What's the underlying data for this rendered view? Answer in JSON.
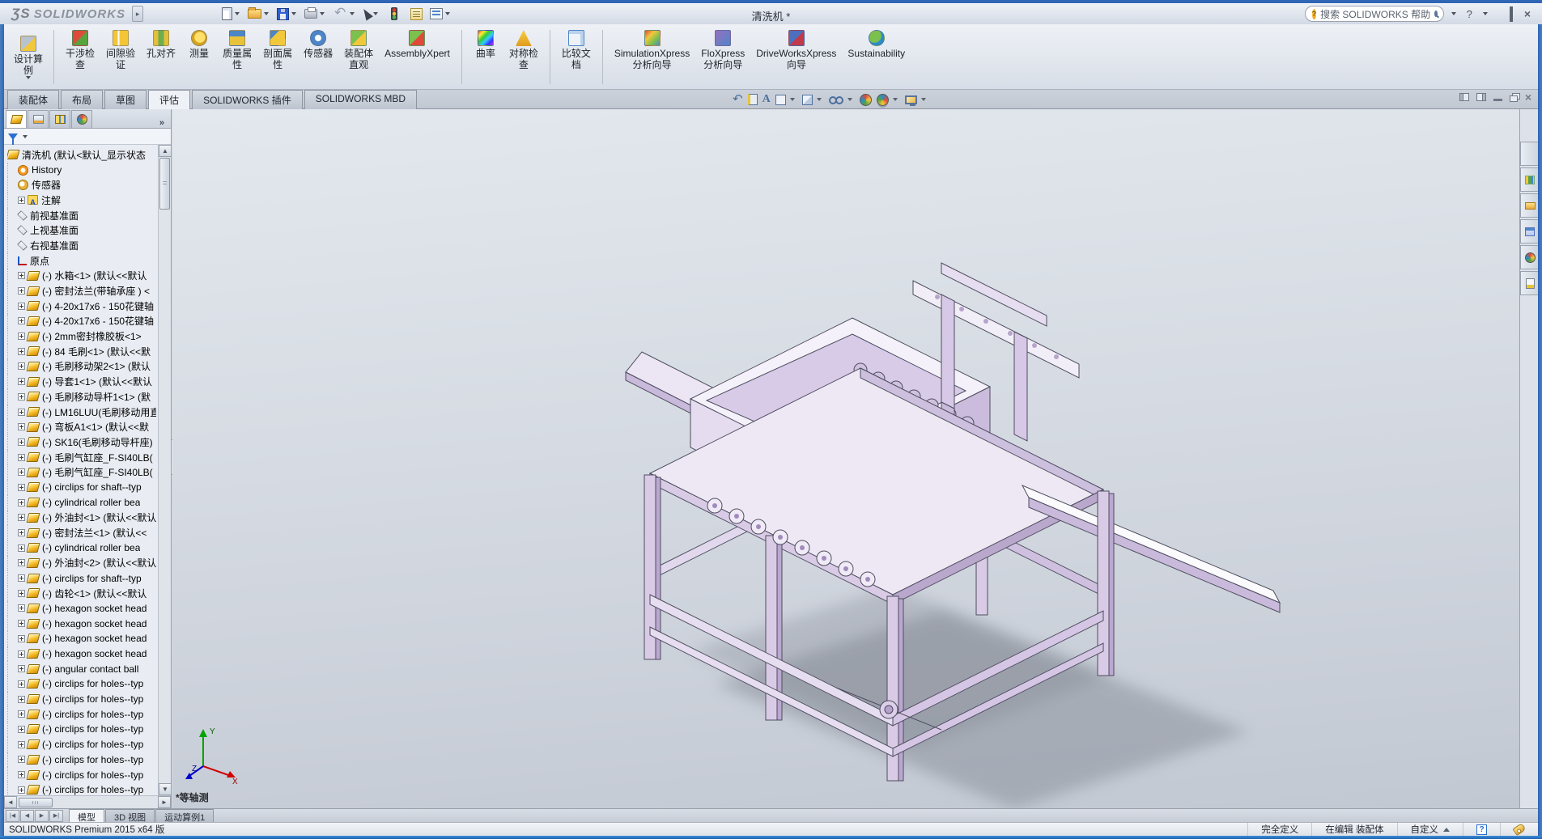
{
  "chrome": {
    "brand_prefix": "ƷS",
    "brand": "SOLIDWORKS",
    "title": "清洗机 *",
    "search_placeholder": "搜索 SOLIDWORKS 帮助",
    "help_glyph": "?",
    "close_glyph": "×"
  },
  "main_toolbar": [
    {
      "name": "new-document",
      "dropdown": true
    },
    {
      "name": "open",
      "dropdown": true
    },
    {
      "name": "save",
      "dropdown": true
    },
    {
      "name": "print",
      "dropdown": true
    },
    {
      "name": "undo",
      "dropdown": true,
      "glyph": "↶"
    },
    {
      "name": "select",
      "dropdown": true,
      "pressed": true
    },
    {
      "name": "rebuild",
      "dropdown": false
    },
    {
      "name": "file-properties",
      "dropdown": false
    },
    {
      "name": "options",
      "dropdown": true
    }
  ],
  "ribbon": {
    "primary": {
      "name": "design-study",
      "label": "设计算\n例"
    },
    "groups": [
      {
        "items": [
          {
            "name": "interference-detection",
            "label": "干涉检\n查"
          },
          {
            "name": "clearance-verification",
            "label": "间隙验\n证"
          },
          {
            "name": "hole-alignment",
            "label": "孔对齐"
          },
          {
            "name": "measure",
            "label": "测量"
          },
          {
            "name": "mass-properties",
            "label": "质量属\n性"
          },
          {
            "name": "section-properties",
            "label": "剖面属\n性"
          },
          {
            "name": "sensor",
            "label": "传感器"
          },
          {
            "name": "assembly-visualization",
            "label": "装配体\n直观"
          },
          {
            "name": "assemblyxpert",
            "label": "AssemblyXpert"
          }
        ]
      },
      {
        "items": [
          {
            "name": "curvature",
            "label": "曲率"
          },
          {
            "name": "symmetry-check",
            "label": "对称检\n查"
          }
        ]
      },
      {
        "items": [
          {
            "name": "compare-documents",
            "label": "比较文\n档"
          }
        ]
      },
      {
        "items": [
          {
            "name": "simulationxpress",
            "label": "SimulationXpress\n分析向导"
          },
          {
            "name": "floxpress",
            "label": "FloXpress\n分析向导"
          },
          {
            "name": "driveworksxpress",
            "label": "DriveWorksXpress\n向导"
          },
          {
            "name": "sustainability",
            "label": "Sustainability"
          }
        ]
      }
    ]
  },
  "cm_tabs": [
    {
      "label": "装配体"
    },
    {
      "label": "布局"
    },
    {
      "label": "草图"
    },
    {
      "label": "评估",
      "active": true
    },
    {
      "label": "SOLIDWORKS 插件"
    },
    {
      "label": "SOLIDWORKS MBD"
    }
  ],
  "headsup": [
    {
      "name": "zoom-to-fit",
      "shape": "mag"
    },
    {
      "name": "zoom-to-area",
      "shape": "mag"
    },
    {
      "name": "previous-view",
      "shape": "prev",
      "glyph": "↶"
    },
    {
      "name": "section-view",
      "shape": "section"
    },
    {
      "name": "3d-drawing-view",
      "shape": "a",
      "glyph": "A"
    },
    {
      "name": "view-orientation",
      "shape": "box",
      "dropdown": true
    },
    {
      "name": "display-style",
      "shape": "cube",
      "dropdown": true
    },
    {
      "name": "hide-show-items",
      "shape": "glasses",
      "dropdown": true
    },
    {
      "name": "edit-appearance",
      "shape": "ball"
    },
    {
      "name": "apply-scene",
      "shape": "scene",
      "dropdown": true
    },
    {
      "name": "view-settings",
      "shape": "monitor",
      "dropdown": true
    }
  ],
  "fm_tabs": [
    {
      "name": "featuremanager-tree",
      "active": true,
      "icon": "feature"
    },
    {
      "name": "propertymanager",
      "icon": "prop"
    },
    {
      "name": "configurationmanager",
      "icon": "config"
    },
    {
      "name": "displaymanager",
      "icon": "display"
    }
  ],
  "fm_more_glyph": "»",
  "tree": {
    "root": {
      "icon": "asm",
      "label": "清洗机 (默认<默认_显示状态"
    },
    "items": [
      {
        "icon": "history",
        "label": "History"
      },
      {
        "icon": "sensor",
        "label": "传感器"
      },
      {
        "icon": "note",
        "exp": true,
        "label": "注解"
      },
      {
        "icon": "plane",
        "label": "前视基准面"
      },
      {
        "icon": "plane",
        "label": "上视基准面"
      },
      {
        "icon": "plane",
        "label": "右视基准面"
      },
      {
        "icon": "origin",
        "label": "原点"
      },
      {
        "icon": "part",
        "exp": true,
        "label": "(-) 水箱<1> (默认<<默认"
      },
      {
        "icon": "part",
        "exp": true,
        "label": "(-) 密封法兰(带轴承座 ) <"
      },
      {
        "icon": "part",
        "exp": true,
        "label": "(-) 4-20x17x6 - 150花键轴"
      },
      {
        "icon": "part",
        "exp": true,
        "label": "(-) 4-20x17x6 - 150花键轴"
      },
      {
        "icon": "part",
        "exp": true,
        "label": "(-) 2mm密封橡胶板<1>"
      },
      {
        "icon": "part",
        "exp": true,
        "label": "(-) 84 毛刷<1> (默认<<默"
      },
      {
        "icon": "part",
        "exp": true,
        "label": "(-) 毛刷移动架2<1> (默认"
      },
      {
        "icon": "part",
        "exp": true,
        "label": "(-) 导套1<1> (默认<<默认"
      },
      {
        "icon": "part",
        "exp": true,
        "label": "(-) 毛刷移动导杆1<1> (默"
      },
      {
        "icon": "part",
        "exp": true,
        "label": "(-) LM16LUU(毛刷移动用直"
      },
      {
        "icon": "part",
        "exp": true,
        "label": "(-) 弯板A1<1> (默认<<默"
      },
      {
        "icon": "part",
        "exp": true,
        "label": "(-) SK16(毛刷移动导杆座)"
      },
      {
        "icon": "part",
        "exp": true,
        "label": "(-) 毛刷气缸座_F-SI40LB("
      },
      {
        "icon": "part",
        "exp": true,
        "label": "(-) 毛刷气缸座_F-SI40LB("
      },
      {
        "icon": "part",
        "exp": true,
        "label": "(-) circlips for shaft--typ"
      },
      {
        "icon": "part",
        "exp": true,
        "label": "(-) cylindrical roller bea"
      },
      {
        "icon": "part",
        "exp": true,
        "label": "(-) 外油封<1> (默认<<默认"
      },
      {
        "icon": "part",
        "exp": true,
        "label": "(-) 密封法兰<1> (默认<<"
      },
      {
        "icon": "part",
        "exp": true,
        "label": "(-) cylindrical roller bea"
      },
      {
        "icon": "part",
        "exp": true,
        "label": "(-) 外油封<2> (默认<<默认"
      },
      {
        "icon": "part",
        "exp": true,
        "label": "(-) circlips for shaft--typ"
      },
      {
        "icon": "part",
        "exp": true,
        "label": "(-) 齿轮<1> (默认<<默认"
      },
      {
        "icon": "part",
        "exp": true,
        "label": "(-) hexagon socket head"
      },
      {
        "icon": "part",
        "exp": true,
        "label": "(-) hexagon socket head"
      },
      {
        "icon": "part",
        "exp": true,
        "label": "(-) hexagon socket head"
      },
      {
        "icon": "part",
        "exp": true,
        "label": "(-) hexagon socket head"
      },
      {
        "icon": "part",
        "exp": true,
        "label": "(-) angular contact ball"
      },
      {
        "icon": "part",
        "exp": true,
        "label": "(-) circlips for holes--typ"
      },
      {
        "icon": "part",
        "exp": true,
        "label": "(-) circlips for holes--typ"
      },
      {
        "icon": "part",
        "exp": true,
        "label": "(-) circlips for holes--typ"
      },
      {
        "icon": "part",
        "exp": true,
        "label": "(-) circlips for holes--typ"
      },
      {
        "icon": "part",
        "exp": true,
        "label": "(-) circlips for holes--typ"
      },
      {
        "icon": "part",
        "exp": true,
        "label": "(-) circlips for holes--typ"
      },
      {
        "icon": "part",
        "exp": true,
        "label": "(-) circlips for holes--typ"
      },
      {
        "icon": "part",
        "exp": true,
        "label": "(-) circlips for holes--typ"
      }
    ],
    "scroll_up_glyph": "▲",
    "scroll_down_glyph": "▼",
    "scroll_left_glyph": "◄",
    "scroll_right_glyph": "►"
  },
  "panel_handle_glyph": "◄",
  "viewport": {
    "view_label": "*等轴测",
    "triad": {
      "x": "X",
      "y": "Y",
      "z": "Z"
    }
  },
  "taskpane": [
    {
      "name": "home"
    },
    {
      "name": "design-library"
    },
    {
      "name": "file-explorer"
    },
    {
      "name": "view-palette"
    },
    {
      "name": "appearances"
    },
    {
      "name": "custom-properties"
    }
  ],
  "bottom": {
    "nav": [
      {
        "g": "|◀"
      },
      {
        "g": "◀"
      },
      {
        "g": "▶"
      },
      {
        "g": "▶|"
      }
    ],
    "tabs": [
      {
        "label": "模型",
        "active": true
      },
      {
        "label": "3D 视图"
      },
      {
        "label": "运动算例1"
      }
    ]
  },
  "statusbar": {
    "left": "SOLIDWORKS Premium 2015 x64 版",
    "defined": "完全定义",
    "editing": "在编辑 装配体",
    "custom": "自定义",
    "help": "?"
  },
  "colors": {
    "accent_blue": "#2f66b5",
    "part_gold": "#f3b61f",
    "model_lavender": "#d8c9e8",
    "viewport_top": "#e3e8ee",
    "viewport_bottom": "#c2c8d2"
  }
}
